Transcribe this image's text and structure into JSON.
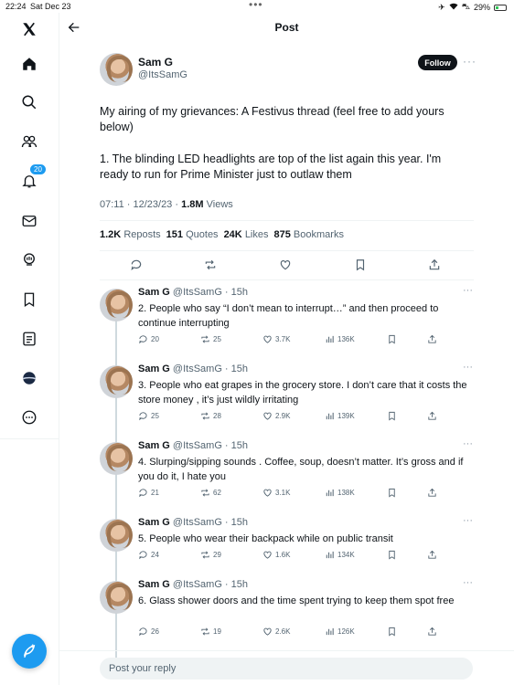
{
  "status_bar": {
    "time": "22:24",
    "date": "Sat Dec 23",
    "battery": "29%",
    "battery_level": 0.29
  },
  "sidebar": {
    "notifications_badge": "20",
    "items": [
      "x-logo-icon",
      "home-icon",
      "search-icon",
      "communities-icon",
      "notifications-icon",
      "messages-icon",
      "grok-icon",
      "bookmarks-icon",
      "lists-icon",
      "profile-icon",
      "more-icon"
    ]
  },
  "header": {
    "title": "Post"
  },
  "post": {
    "author_name": "Sam G",
    "author_handle": "@ItsSamG",
    "follow_label": "Follow",
    "text_line1": "My airing of my grievances: A Festivus thread (feel free to add yours below)",
    "text_line2": "1. The blinding LED headlights are top of the list again this year. I'm ready to run for Prime Minister just to outlaw them",
    "timestamp": "07:11 · 12/23/23 · ",
    "views_count": "1.8M",
    "views_label": " Views",
    "reposts_count": "1.2K",
    "reposts_label": "Reposts",
    "quotes_count": "151",
    "quotes_label": "Quotes",
    "likes_count": "24K",
    "likes_label": "Likes",
    "bookmarks_count": "875",
    "bookmarks_label": "Bookmarks"
  },
  "replies": [
    {
      "name": "Sam G",
      "meta": "@ItsSamG · 15h",
      "text": "2. People who say “I don’t mean to interrupt…” and then proceed to continue interrupting",
      "replies": "20",
      "reposts": "25",
      "likes": "3.7K",
      "views": "136K"
    },
    {
      "name": "Sam G",
      "meta": "@ItsSamG · 15h",
      "text": "3. People who eat grapes in the grocery store. I don’t care that it costs the store money , it’s just wildly irritating",
      "replies": "25",
      "reposts": "28",
      "likes": "2.9K",
      "views": "139K"
    },
    {
      "name": "Sam G",
      "meta": "@ItsSamG · 15h",
      "text": "4. Slurping/sipping sounds . Coffee, soup, doesn’t matter. It’s gross and if you do it, I hate you",
      "replies": "21",
      "reposts": "62",
      "likes": "3.1K",
      "views": "138K"
    },
    {
      "name": "Sam G",
      "meta": "@ItsSamG · 15h",
      "text": "5. People who wear their backpack while on public transit",
      "replies": "24",
      "reposts": "29",
      "likes": "1.6K",
      "views": "134K"
    },
    {
      "name": "Sam G",
      "meta": "@ItsSamG · 15h",
      "text": "6. Glass shower doors and the time spent trying to keep them spot free",
      "replies": "26",
      "reposts": "19",
      "likes": "2.6K",
      "views": "126K"
    }
  ],
  "reply_box": {
    "placeholder": "Post your reply"
  },
  "colors": {
    "accent": "#1d9bf0",
    "text": "#0f1419",
    "muted": "#536471"
  }
}
